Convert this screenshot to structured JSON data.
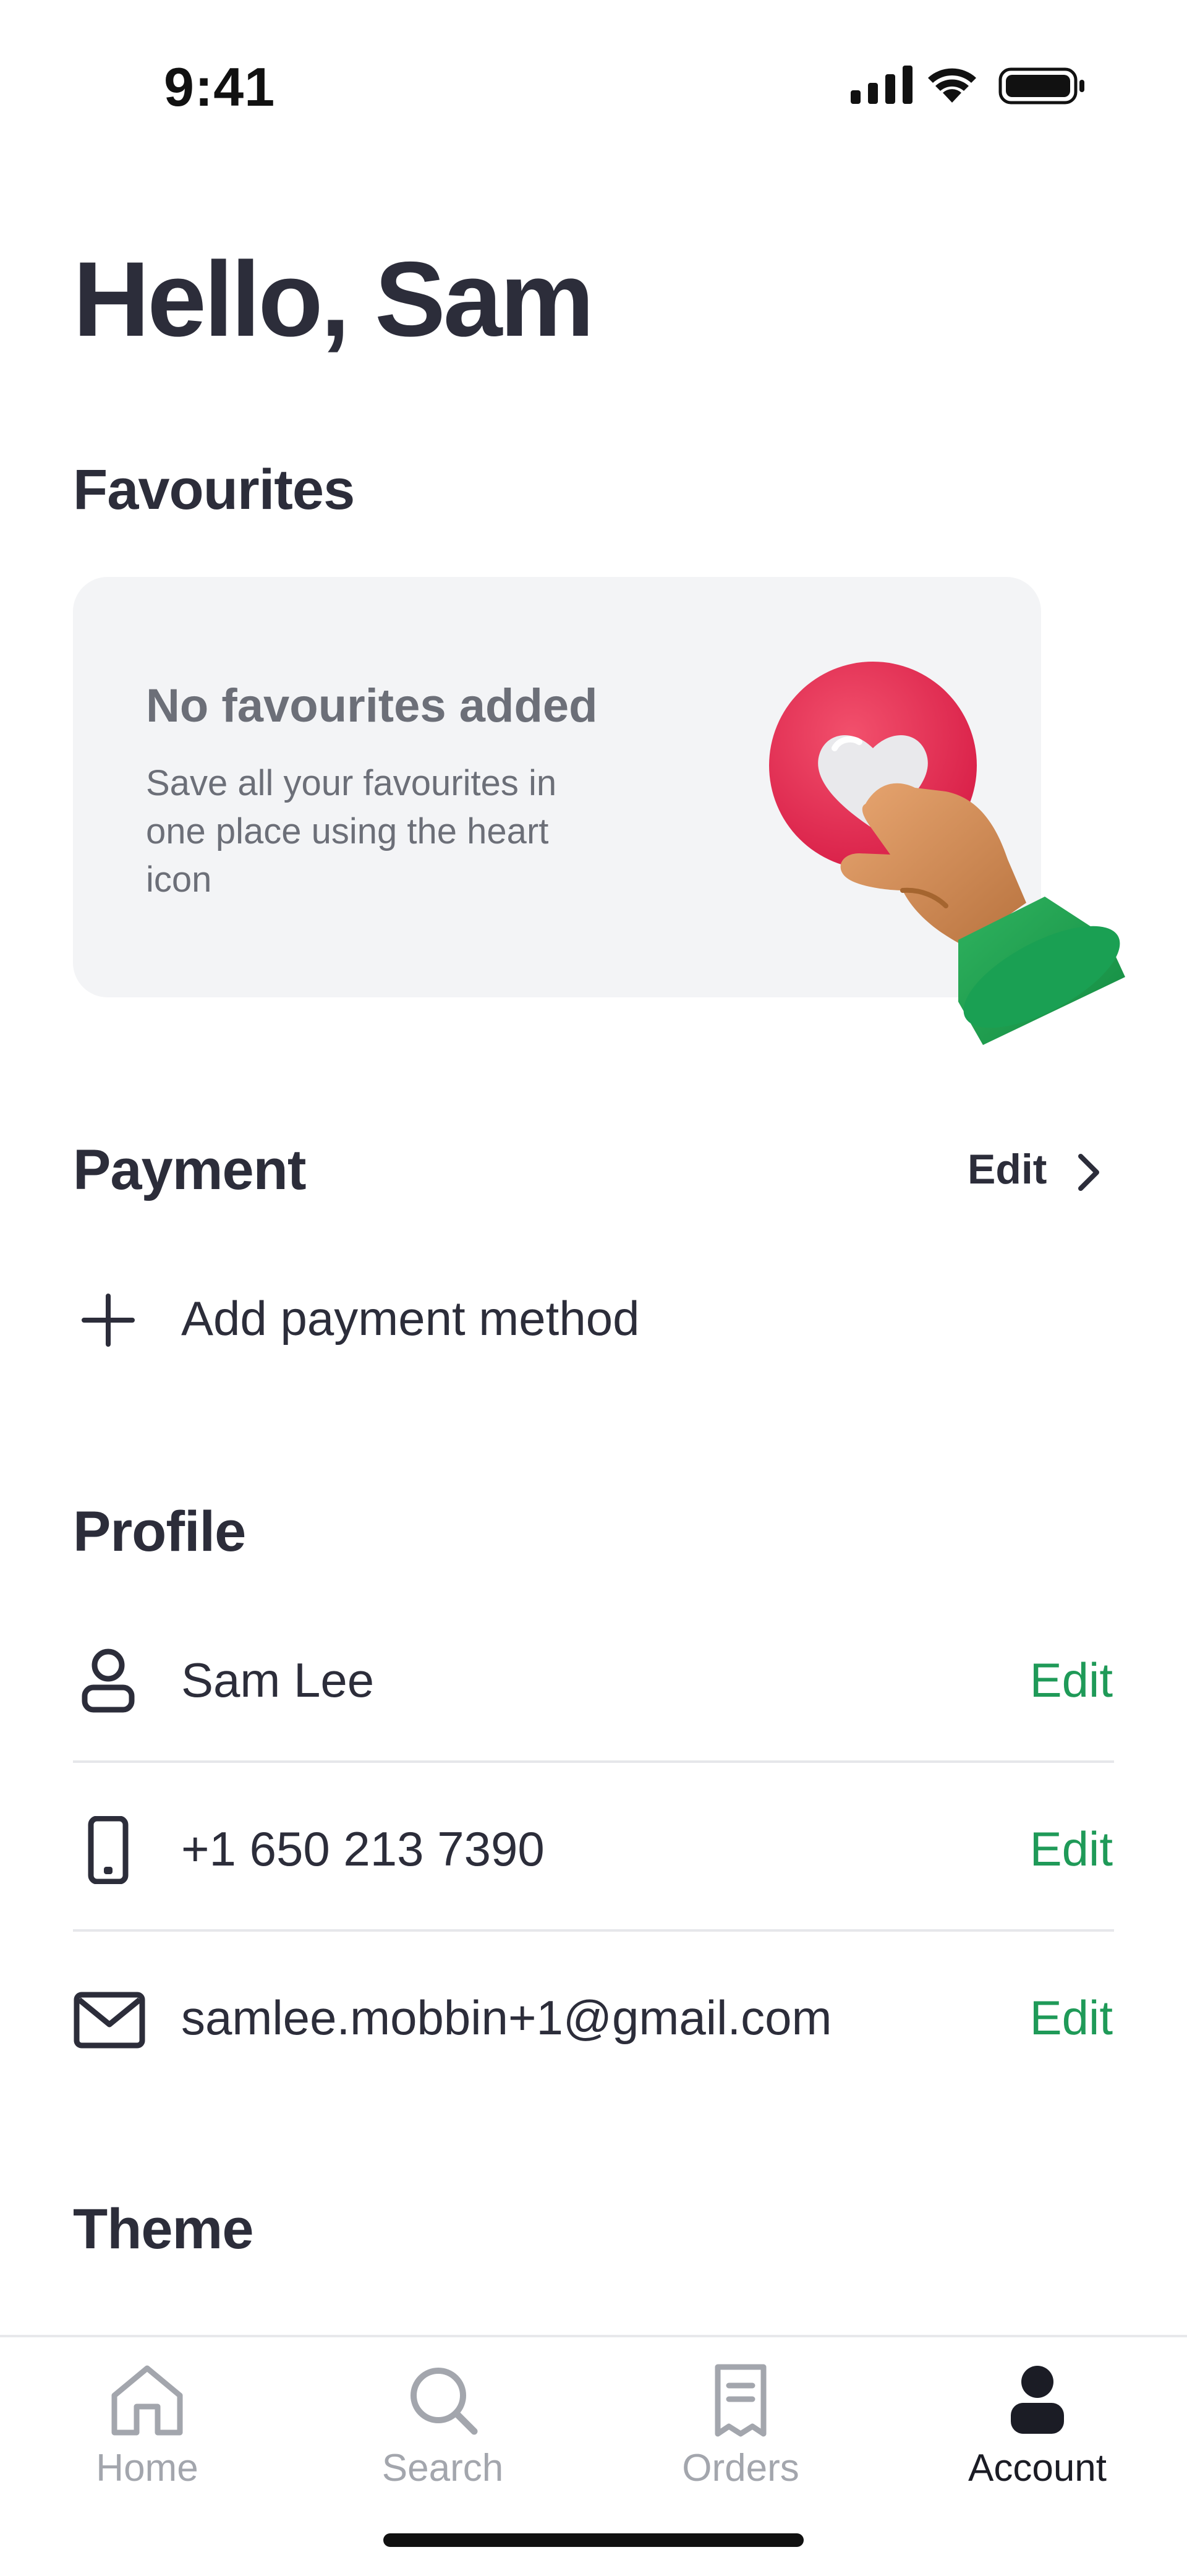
{
  "status_bar": {
    "time": "9:41"
  },
  "header": {
    "greeting": "Hello, Sam"
  },
  "favourites": {
    "title": "Favourites",
    "empty_title": "No favourites added",
    "empty_description": "Save all your favourites in one place using the heart icon",
    "illustration_icon": "hand-tapping-heart-icon"
  },
  "payment": {
    "title": "Payment",
    "edit_label": "Edit",
    "add_label": "Add payment method"
  },
  "profile": {
    "title": "Profile",
    "rows": [
      {
        "icon": "person-icon",
        "value": "Sam Lee",
        "edit_label": "Edit"
      },
      {
        "icon": "phone-icon",
        "value": "+1 650 213 7390",
        "edit_label": "Edit"
      },
      {
        "icon": "mail-icon",
        "value": "samlee.mobbin+1@gmail.com",
        "edit_label": "Edit"
      }
    ]
  },
  "theme": {
    "title": "Theme"
  },
  "bottom_nav": {
    "items": [
      {
        "label": "Home",
        "icon": "home-icon",
        "active": false
      },
      {
        "label": "Search",
        "icon": "search-icon",
        "active": false
      },
      {
        "label": "Orders",
        "icon": "receipt-icon",
        "active": false
      },
      {
        "label": "Account",
        "icon": "person-filled-icon",
        "active": true
      }
    ]
  },
  "colors": {
    "text_primary": "#2c2d3a",
    "text_muted": "#6c6f78",
    "accent_green": "#1f9a58",
    "card_background": "#f3f4f6",
    "nav_inactive": "#a3a6ad",
    "nav_active": "#1b1c25"
  }
}
